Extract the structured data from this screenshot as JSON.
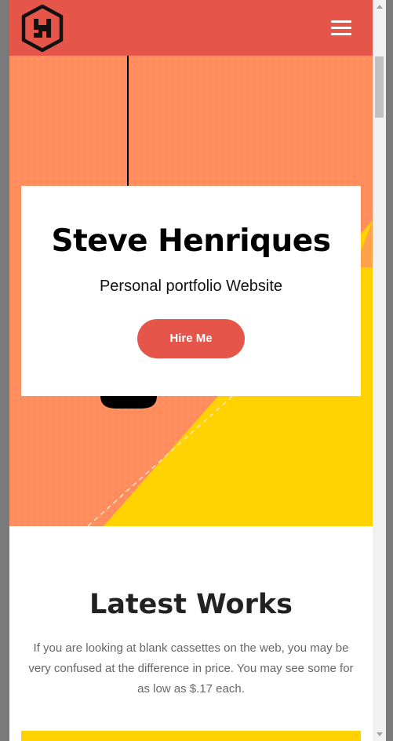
{
  "header": {
    "logo_icon": "hexagon-h-logo-icon",
    "menu_icon": "hamburger-menu-icon",
    "background_color": "#e5554a"
  },
  "hero": {
    "name": "Steve Henriques",
    "tagline": "Personal portfolio Website",
    "cta_label": "Hire Me",
    "colors": {
      "orange": "#ff8c5c",
      "yellow": "#ffd200",
      "accent": "#e5554a"
    }
  },
  "works": {
    "title": "Latest Works",
    "description": "If you are looking at blank cassettes on the web, you may be very confused at the difference in price. You may see some for as low as $.17 each."
  }
}
